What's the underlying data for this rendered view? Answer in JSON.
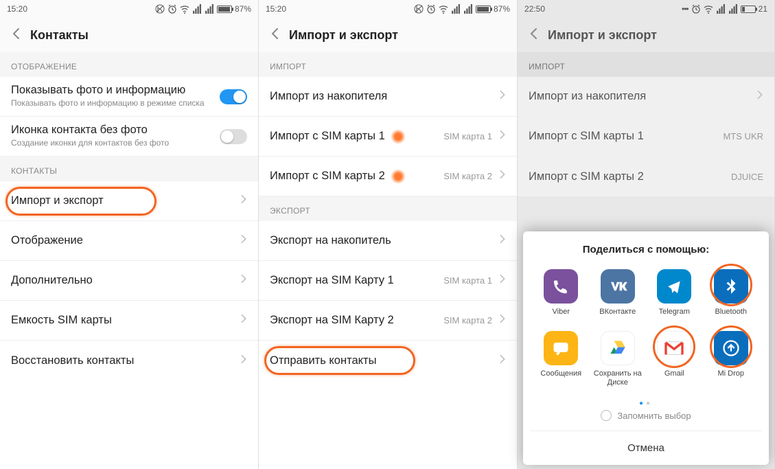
{
  "panel1": {
    "status": {
      "time": "15:20",
      "battery": "87%",
      "batt_level": 87
    },
    "title": "Контакты",
    "section_display": "ОТОБРАЖЕНИЕ",
    "row_show_photo": {
      "label": "Показывать фото и информацию",
      "sub": "Показывать фото и информацию в режиме списка"
    },
    "row_default_icon": {
      "label": "Иконка контакта без фото",
      "sub": "Создание иконки для контактов без фото"
    },
    "section_contacts": "КОНТАКТЫ",
    "row_import_export": "Импорт и экспорт",
    "row_display": "Отображение",
    "row_more": "Дополнительно",
    "row_sim_capacity": "Емкость SIM карты",
    "row_restore": "Восстановить контакты"
  },
  "panel2": {
    "status": {
      "time": "15:20",
      "battery": "87%",
      "batt_level": 87
    },
    "title": "Импорт и экспорт",
    "section_import": "ИМПОРТ",
    "row_import_storage": "Импорт из накопителя",
    "row_import_sim1": {
      "label": "Импорт с SIM карты 1",
      "tail": "SIM карта 1"
    },
    "row_import_sim2": {
      "label": "Импорт с SIM карты 2",
      "tail": "SIM карта 2"
    },
    "section_export": "ЭКСПОРТ",
    "row_export_storage": "Экспорт на накопитель",
    "row_export_sim1": {
      "label": "Экспорт на SIM Карту 1",
      "tail": "SIM карта 1"
    },
    "row_export_sim2": {
      "label": "Экспорт на SIM Карту 2",
      "tail": "SIM карта 2"
    },
    "row_send": "Отправить контакты"
  },
  "panel3": {
    "status": {
      "time": "22:50",
      "battery": "21",
      "batt_level": 21
    },
    "title": "Импорт и экспорт",
    "section_import": "ИМПОРТ",
    "row_import_storage": "Импорт из накопителя",
    "row_import_sim1": {
      "label": "Импорт с SIM карты 1",
      "tail": "MTS UKR"
    },
    "row_import_sim2": {
      "label": "Импорт с SIM карты 2",
      "tail": "DJUICE"
    },
    "share_title": "Поделиться с помощью:",
    "apps": {
      "viber": "Viber",
      "vk": "ВКонтакте",
      "telegram": "Telegram",
      "bluetooth": "Bluetooth",
      "messages": "Сообщения",
      "drive": "Сохранить на Диске",
      "gmail": "Gmail",
      "midrop": "Mi Drop"
    },
    "remember": "Запомнить выбор",
    "cancel": "Отмена"
  }
}
